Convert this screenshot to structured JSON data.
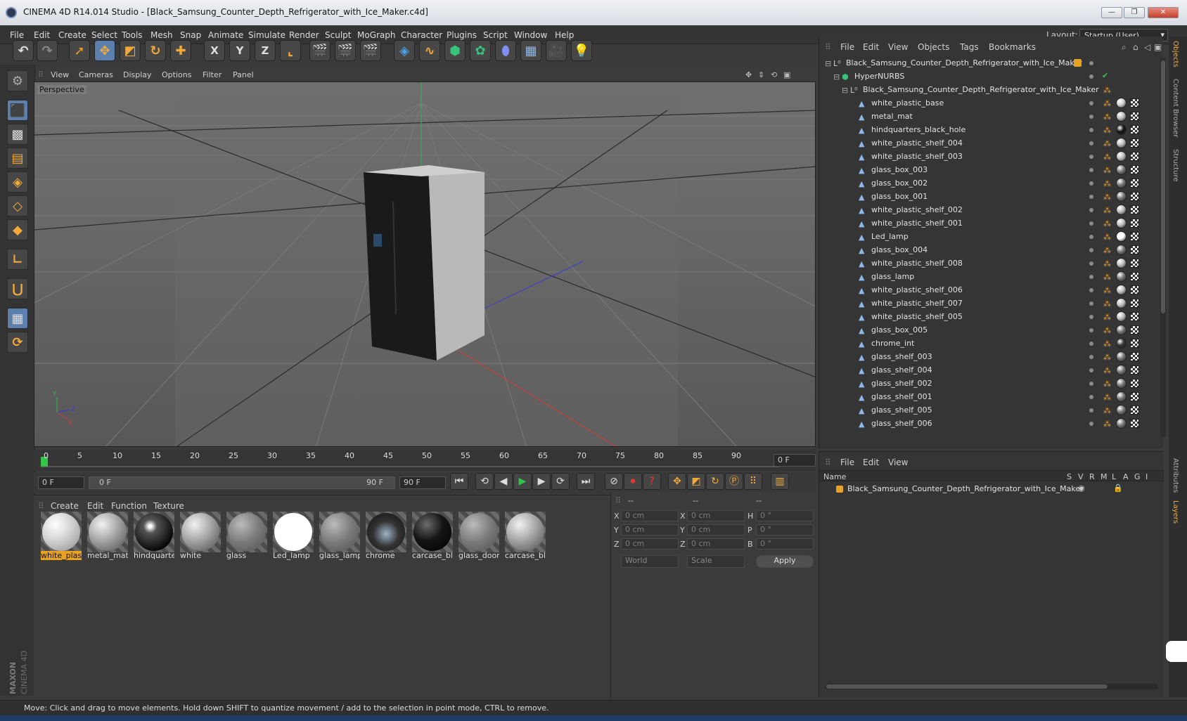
{
  "window": {
    "title": "CINEMA 4D R14.014 Studio - [Black_Samsung_Counter_Depth_Refrigerator_with_Ice_Maker.c4d]",
    "min": "—",
    "max": "❐",
    "close": "✕"
  },
  "menubar": [
    "File",
    "Edit",
    "Create",
    "Select",
    "Tools",
    "Mesh",
    "Snap",
    "Animate",
    "Simulate",
    "Render",
    "Sculpt",
    "MoGraph",
    "Character",
    "Plugins",
    "Script",
    "Window",
    "Help"
  ],
  "layout": {
    "label": "Layout:",
    "value": "Startup (User)"
  },
  "toolbar_axes": [
    "X",
    "Y",
    "Z"
  ],
  "viewport": {
    "menu": [
      "View",
      "Cameras",
      "Display",
      "Options",
      "Filter",
      "Panel"
    ],
    "label": "Perspective",
    "axis_labels": [
      "Y",
      "Z",
      "X"
    ]
  },
  "timeline": {
    "ticks": [
      "0",
      "5",
      "10",
      "15",
      "20",
      "25",
      "30",
      "35",
      "40",
      "45",
      "50",
      "55",
      "60",
      "65",
      "70",
      "75",
      "80",
      "85",
      "90"
    ],
    "current_frame": "0 F",
    "start_field": "0 F",
    "range_start": "0 F",
    "range_end": "90 F",
    "end_field": "90 F"
  },
  "materials": {
    "menu": [
      "Create",
      "Edit",
      "Function",
      "Texture"
    ],
    "items": [
      {
        "name": "white_plas",
        "kind": "white",
        "selected": true
      },
      {
        "name": "metal_mat",
        "kind": "grey"
      },
      {
        "name": "hindquarte",
        "kind": "black-shiny"
      },
      {
        "name": "white",
        "kind": "grey"
      },
      {
        "name": "glass",
        "kind": "glass"
      },
      {
        "name": "Led_lamp",
        "kind": "pure-white"
      },
      {
        "name": "glass_lamp",
        "kind": "glass"
      },
      {
        "name": "chrome",
        "kind": "chrome"
      },
      {
        "name": "carcase_bla",
        "kind": "black"
      },
      {
        "name": "glass_door",
        "kind": "glass"
      },
      {
        "name": "carcase_bla",
        "kind": "grey"
      }
    ]
  },
  "coords": {
    "headers": [
      "--",
      "--",
      "--"
    ],
    "rows": [
      {
        "a": "X",
        "av": "0 cm",
        "b": "X",
        "bv": "0 cm",
        "c": "H",
        "cv": "0 °"
      },
      {
        "a": "Y",
        "av": "0 cm",
        "b": "Y",
        "bv": "0 cm",
        "c": "P",
        "cv": "0 °"
      },
      {
        "a": "Z",
        "av": "0 cm",
        "b": "Z",
        "bv": "0 cm",
        "c": "B",
        "cv": "0 °"
      }
    ],
    "mode1": "World",
    "mode2": "Scale",
    "apply": "Apply"
  },
  "objects": {
    "menu": [
      "File",
      "Edit",
      "View",
      "Objects",
      "Tags",
      "Bookmarks"
    ],
    "root": "Black_Samsung_Counter_Depth_Refrigerator_with_Ice_Maker",
    "hypernurbs": "HyperNURBS",
    "group": "Black_Samsung_Counter_Depth_Refrigerator_with_Ice_Maker",
    "children": [
      {
        "name": "white_plastic_base",
        "mat": "#cfcfcf"
      },
      {
        "name": "metal_mat",
        "mat": "#bdbdbd"
      },
      {
        "name": "hindquarters_black_hole",
        "mat": "#111111"
      },
      {
        "name": "white_plastic_shelf_004",
        "mat": "#bdbdbd"
      },
      {
        "name": "white_plastic_shelf_003",
        "mat": "#bdbdbd"
      },
      {
        "name": "glass_box_003",
        "mat": "#777777"
      },
      {
        "name": "glass_box_002",
        "mat": "#777777"
      },
      {
        "name": "glass_box_001",
        "mat": "#777777"
      },
      {
        "name": "white_plastic_shelf_002",
        "mat": "#bdbdbd"
      },
      {
        "name": "white_plastic_shelf_001",
        "mat": "#bdbdbd"
      },
      {
        "name": "Led_lamp",
        "mat": "#ffffff"
      },
      {
        "name": "glass_box_004",
        "mat": "#777777"
      },
      {
        "name": "white_plastic_shelf_008",
        "mat": "#bdbdbd"
      },
      {
        "name": "glass_lamp",
        "mat": "#777777"
      },
      {
        "name": "white_plastic_shelf_006",
        "mat": "#bdbdbd"
      },
      {
        "name": "white_plastic_shelf_007",
        "mat": "#bdbdbd"
      },
      {
        "name": "white_plastic_shelf_005",
        "mat": "#bdbdbd"
      },
      {
        "name": "glass_box_005",
        "mat": "#777777"
      },
      {
        "name": "chrome_int",
        "mat": "#333333"
      },
      {
        "name": "glass_shelf_003",
        "mat": "#777777"
      },
      {
        "name": "glass_shelf_004",
        "mat": "#777777"
      },
      {
        "name": "glass_shelf_002",
        "mat": "#777777"
      },
      {
        "name": "glass_shelf_001",
        "mat": "#777777"
      },
      {
        "name": "glass_shelf_005",
        "mat": "#777777"
      },
      {
        "name": "glass_shelf_006",
        "mat": "#777777"
      }
    ]
  },
  "layers": {
    "menu": [
      "File",
      "Edit",
      "View"
    ],
    "column_name": "Name",
    "columns": [
      "S",
      "V",
      "R",
      "M",
      "L",
      "A",
      "G",
      "I"
    ],
    "row": "Black_Samsung_Counter_Depth_Refrigerator_with_Ice_Maker"
  },
  "side_tabs": [
    "Objects",
    "Content Browser",
    "Structure",
    "Attributes",
    "Layers"
  ],
  "status": "Move: Click and drag to move elements. Hold down SHIFT to quantize movement / add to the selection in point mode, CTRL to remove.",
  "logo": {
    "brand": "MAXON",
    "product": "CINEMA 4D"
  }
}
